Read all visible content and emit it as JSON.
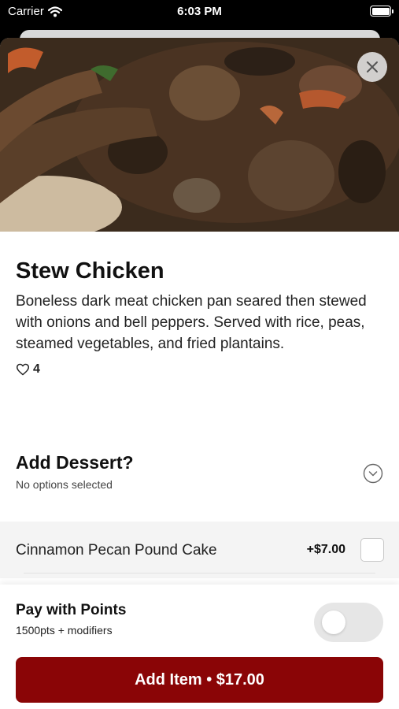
{
  "status_bar": {
    "carrier": "Carrier",
    "time": "6:03 PM"
  },
  "item": {
    "title": "Stew Chicken",
    "description": "Boneless dark meat chicken pan seared then stewed with onions and bell peppers. Served with rice, peas, steamed vegetables, and fried plantains.",
    "likes": "4"
  },
  "dessert": {
    "title": "Add Dessert?",
    "subtitle": "No options selected",
    "options": [
      {
        "name": "Cinnamon Pecan Pound Cake",
        "price": "+$7.00",
        "checked": false
      }
    ]
  },
  "points": {
    "title": "Pay with Points",
    "subtitle": "1500pts + modifiers",
    "enabled": false
  },
  "add_button": {
    "label": "Add Item • $17.00"
  },
  "colors": {
    "accent": "#8a0506",
    "option_bg": "#f4f4f4",
    "toggle_off": "#e6e6e6"
  },
  "icons": {
    "close": "close-icon",
    "like": "heart-outline-icon",
    "expand": "chevron-down-circle-icon",
    "wifi": "wifi-icon",
    "battery": "battery-icon"
  }
}
